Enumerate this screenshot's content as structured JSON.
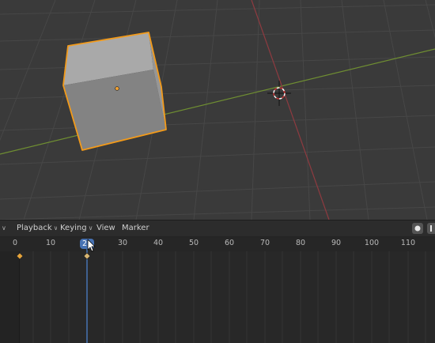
{
  "viewport": {
    "object_name": "cube",
    "grid_color": "#4a4a4a",
    "x_axis_color": "#7d9a35",
    "y_axis_color": "#9b3d44",
    "selection_outline": "#f29a1a",
    "cursor_color": "#cc3333"
  },
  "timeline": {
    "menu": {
      "playback": "Playback",
      "keying": "Keying",
      "view": "View",
      "marker": "Marker"
    },
    "ruler_labels": [
      "0",
      "10",
      "30",
      "40",
      "50",
      "60",
      "70",
      "80",
      "90",
      "100",
      "110"
    ],
    "current_frame": "2",
    "current_frame_color": "#4772b3",
    "keyframe_color": "#e6a43a"
  }
}
